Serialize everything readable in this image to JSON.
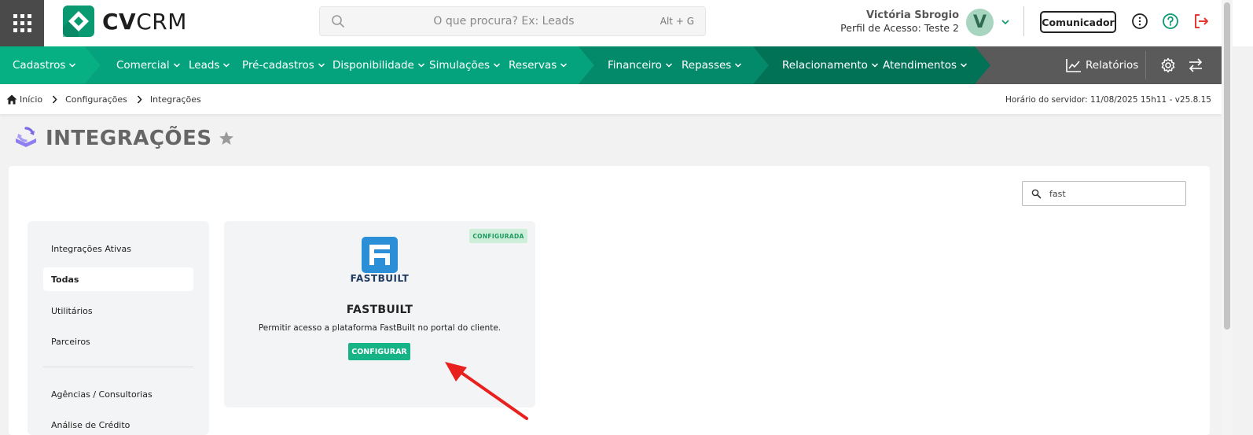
{
  "header": {
    "brand": {
      "bold": "CV",
      "light": "CRM"
    },
    "search": {
      "placeholder": "O que procura? Ex: Leads",
      "shortcut": "Alt + G"
    },
    "user": {
      "name": "Victória Sbrogio",
      "profile": "Perfil de Acesso: Teste 2",
      "avatar_letter": "V"
    },
    "comunicador_label": "Comunicador",
    "icons": [
      "apps-grid-icon",
      "info-icon",
      "help-icon",
      "logout-icon"
    ],
    "colors": {
      "brand_green": "#0a9a72",
      "logout_red": "#e53935",
      "help_green": "#0a9a72"
    }
  },
  "nav": {
    "groups": [
      {
        "color": "#06b083",
        "items": [
          "Cadastros"
        ]
      },
      {
        "color": "#04a37d",
        "items": [
          "Comercial",
          "Leads",
          "Pré-cadastros",
          "Disponibilidade",
          "Simulações",
          "Reservas"
        ]
      },
      {
        "color": "#038a6a",
        "items": [
          "Financeiro",
          "Repasses"
        ]
      },
      {
        "color": "#027257",
        "items": [
          "Relacionamento",
          "Atendimentos"
        ]
      }
    ],
    "reports_label": "Relatórios",
    "right_icons": [
      "chart-icon",
      "gear-icon",
      "swap-icon"
    ]
  },
  "breadcrumb": {
    "items": [
      "Início",
      "Configurações",
      "Integrações"
    ],
    "server_time": "Horário do servidor: 11/08/2025 15h11 - v25.8.15"
  },
  "page": {
    "title": "INTEGRAÇÕES"
  },
  "filter": {
    "value": "fast"
  },
  "sidebar": {
    "items": [
      "Integrações Ativas",
      "Todas",
      "Utilitários",
      "Parceiros",
      "Agências / Consultorias",
      "Análise de Crédito"
    ],
    "active": "Todas"
  },
  "card": {
    "badge": "CONFIGURADA",
    "logo_text": "FASTBUILT",
    "title": "FASTBUILT",
    "description": "Permitir acesso a plataforma FastBuilt no portal do cliente.",
    "button": "CONFIGURAR",
    "colors": {
      "logo_blue": "#2a8fd6",
      "button": "#16b386",
      "badge_bg": "#cdeed9",
      "badge_text": "#1b9a5e"
    }
  },
  "annotation": {
    "arrow_color": "#e8201e"
  }
}
